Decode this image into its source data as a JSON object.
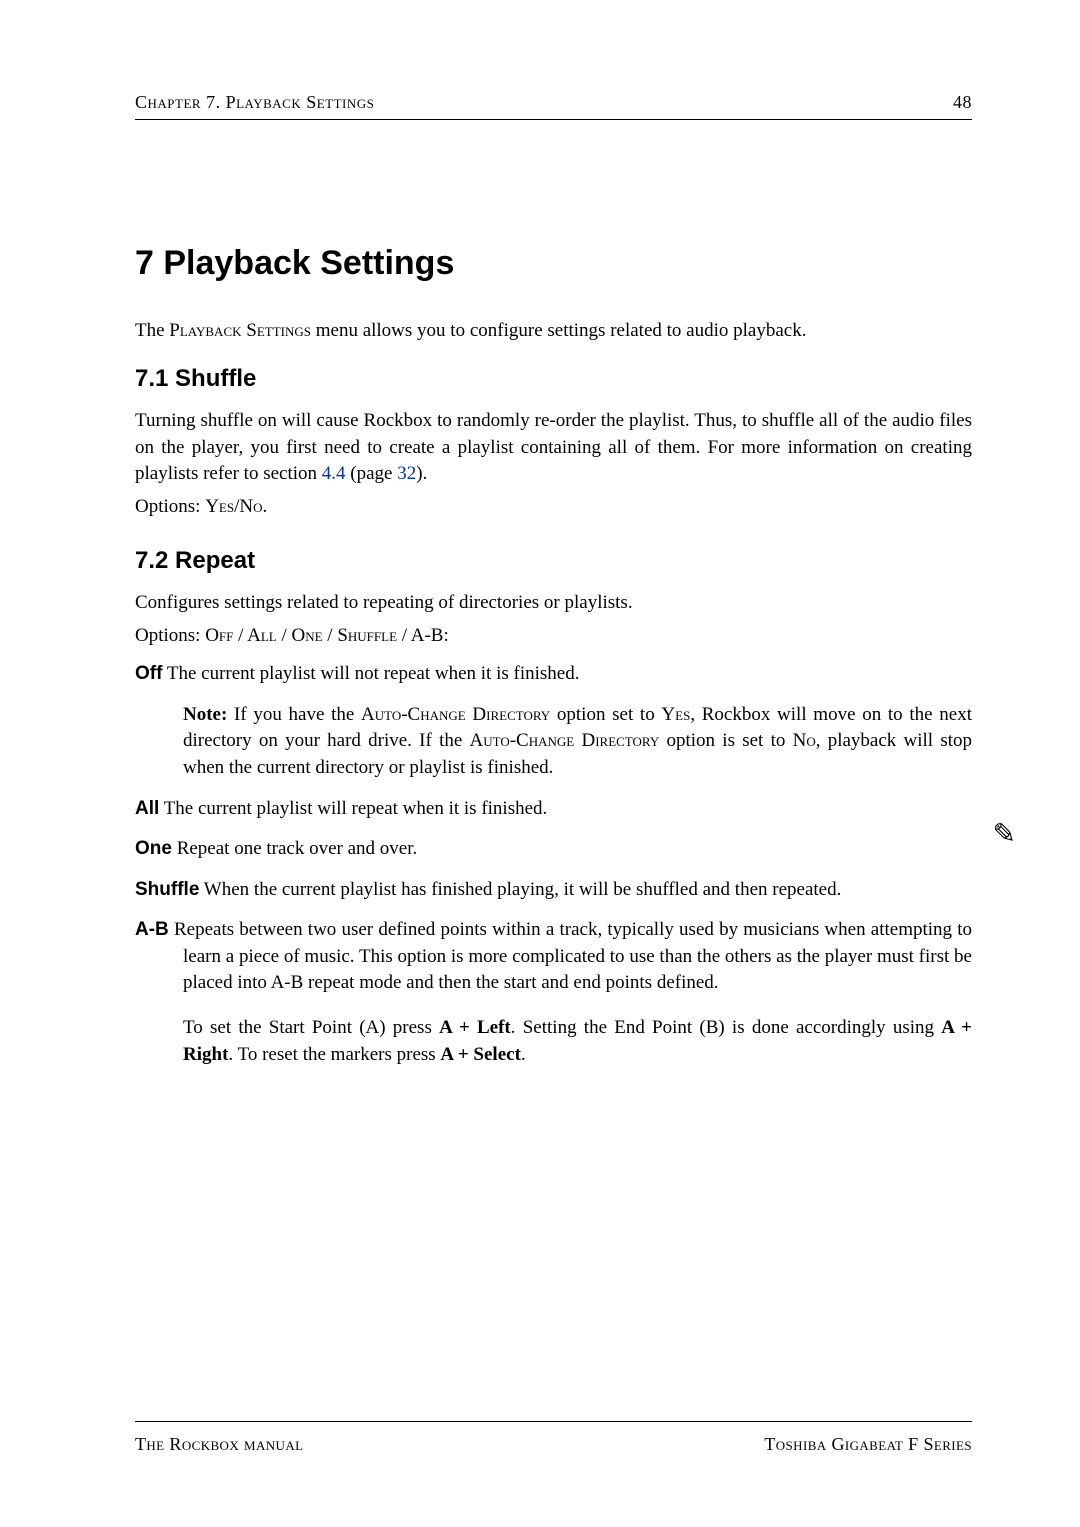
{
  "header": {
    "left": "Chapter 7.  Playback Settings",
    "right": "48"
  },
  "title": "7 Playback Settings",
  "intro_pre": "The ",
  "intro_sc": "Playback Settings",
  "intro_post": " menu allows you to configure settings related to audio playback.",
  "s71": {
    "title": "7.1 Shuffle",
    "p1_a": "Turning shuffle on will cause Rockbox to randomly re-order the playlist. Thus, to shuffle all of the audio files on the player, you first need to create a playlist containing all of them. For more information on creating playlists refer to section ",
    "link_sec": "4.4",
    "p1_b": " (page ",
    "link_page": "32",
    "p1_c": ").",
    "p2_a": "Options: ",
    "p2_sc": "Yes/No",
    "p2_b": "."
  },
  "s72": {
    "title": "7.2 Repeat",
    "p1": "Configures settings related to repeating of directories or playlists.",
    "p2_a": "Options: ",
    "p2_sc": "Off / All / One / Shuffle",
    "p2_b": " / A-B:",
    "off": {
      "label": "Off",
      "text": " The current playlist will not repeat when it is finished."
    },
    "note": {
      "bold": "Note:",
      "a": " If you have the ",
      "sc1": "Auto-Change Directory",
      "b": " option set to ",
      "sc2": "Yes",
      "c": ", Rockbox will move on to the next directory on your hard drive. If the ",
      "sc3": "Auto-Change Directory",
      "d": " option is set to ",
      "sc4": "No",
      "e": ", playback will stop when the current directory or playlist is finished."
    },
    "all": {
      "label": "All",
      "text": " The current playlist will repeat when it is finished."
    },
    "one": {
      "label": "One",
      "text": " Repeat one track over and over."
    },
    "shuffle": {
      "label": "Shuffle",
      "text": " When the current playlist has finished playing, it will be shuffled and then repeated."
    },
    "ab": {
      "label": "A-B",
      "text": " Repeats between two user defined points within a track, typically used by musicians when attempting to learn a piece of music. This option is more complicated to use than the others as the player must first be placed into A-B repeat mode and then the start and end points defined.",
      "p2_a": "To set the Start Point (A) press ",
      "k1": "A + Left",
      "p2_b": ". Setting the End Point (B) is done accordingly using ",
      "k2": "A + Right",
      "p2_c": ". To reset the markers press ",
      "k3": "A + Select",
      "p2_d": "."
    }
  },
  "footer": {
    "left": "The Rockbox manual",
    "right": "Toshiba Gigabeat F Series"
  },
  "icon": "✎"
}
